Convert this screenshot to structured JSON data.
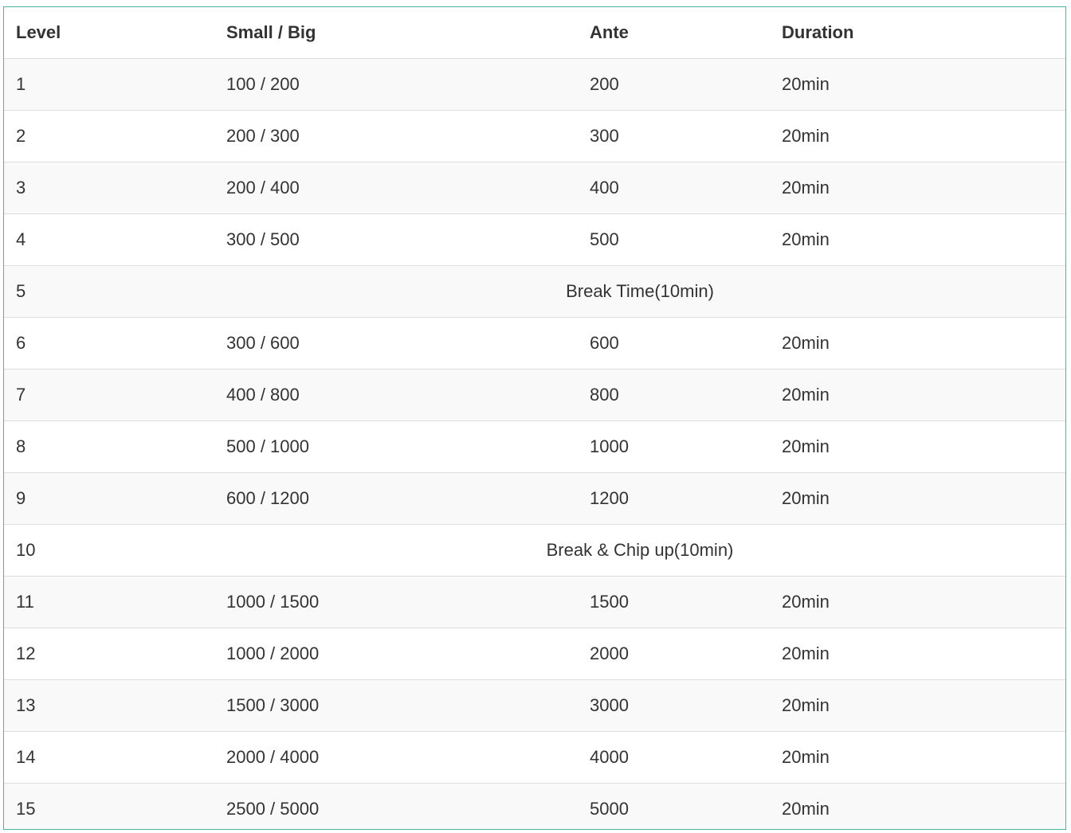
{
  "table": {
    "headers": [
      "Level",
      "Small / Big",
      "Ante",
      "Duration"
    ],
    "rows": [
      {
        "level": "1",
        "blinds": "100 / 200",
        "ante": "200",
        "duration": "20min"
      },
      {
        "level": "2",
        "blinds": "200 / 300",
        "ante": "300",
        "duration": "20min"
      },
      {
        "level": "3",
        "blinds": "200 / 400",
        "ante": "400",
        "duration": "20min"
      },
      {
        "level": "4",
        "blinds": "300 / 500",
        "ante": "500",
        "duration": "20min"
      },
      {
        "level": "5",
        "break": "Break Time(10min)"
      },
      {
        "level": "6",
        "blinds": "300 / 600",
        "ante": "600",
        "duration": "20min"
      },
      {
        "level": "7",
        "blinds": "400 / 800",
        "ante": "800",
        "duration": "20min"
      },
      {
        "level": "8",
        "blinds": "500 / 1000",
        "ante": "1000",
        "duration": "20min"
      },
      {
        "level": "9",
        "blinds": "600 / 1200",
        "ante": "1200",
        "duration": "20min"
      },
      {
        "level": "10",
        "break": "Break & Chip up(10min)"
      },
      {
        "level": "11",
        "blinds": "1000 / 1500",
        "ante": "1500",
        "duration": "20min"
      },
      {
        "level": "12",
        "blinds": "1000 / 2000",
        "ante": "2000",
        "duration": "20min"
      },
      {
        "level": "13",
        "blinds": "1500 / 3000",
        "ante": "3000",
        "duration": "20min"
      },
      {
        "level": "14",
        "blinds": "2000 / 4000",
        "ante": "4000",
        "duration": "20min"
      },
      {
        "level": "15",
        "blinds": "2500 / 5000",
        "ante": "5000",
        "duration": "20min"
      }
    ]
  },
  "colors": {
    "frame_border": "#4ab5a0",
    "stripe": "#f9f9f9",
    "row_border": "#dddddd",
    "text": "#333333"
  }
}
